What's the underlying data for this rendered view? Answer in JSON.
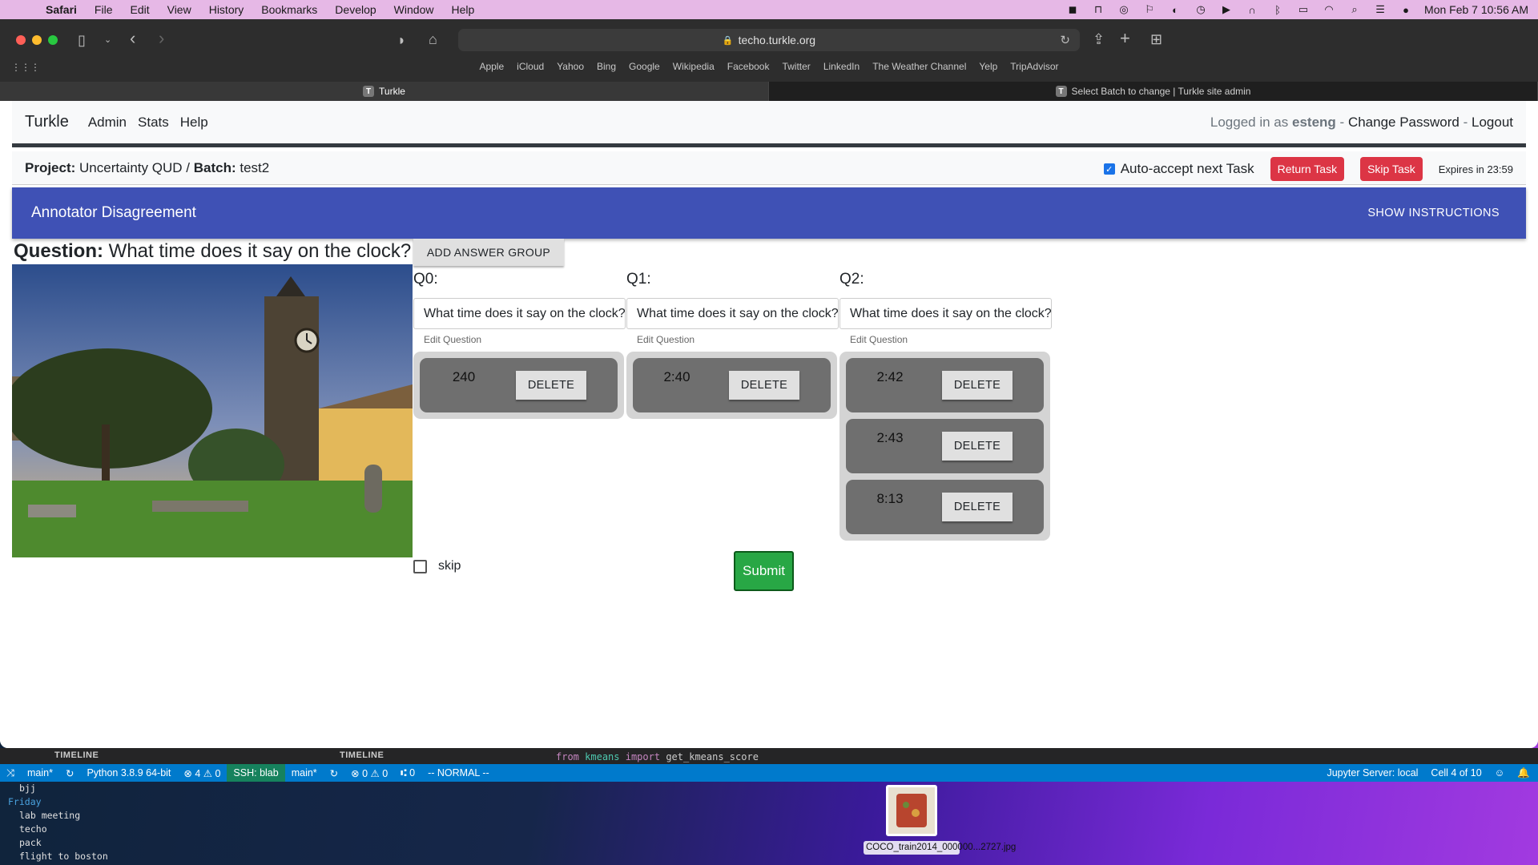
{
  "menubar": {
    "app": "Safari",
    "items": [
      "File",
      "Edit",
      "View",
      "History",
      "Bookmarks",
      "Develop",
      "Window",
      "Help"
    ],
    "datetime": "Mon Feb 7  10:56 AM"
  },
  "browser": {
    "url": "techo.turkle.org",
    "favorites": [
      "Apple",
      "iCloud",
      "Yahoo",
      "Bing",
      "Google",
      "Wikipedia",
      "Facebook",
      "Twitter",
      "LinkedIn",
      "The Weather Channel",
      "Yelp",
      "TripAdvisor"
    ],
    "tabs": [
      {
        "favicon": "T",
        "title": "Turkle"
      },
      {
        "favicon": "T",
        "title": "Select Batch to change | Turkle site admin"
      }
    ]
  },
  "nav": {
    "brand": "Turkle",
    "links": [
      "Admin",
      "Stats",
      "Help"
    ],
    "logged_in_prefix": "Logged in as",
    "username": "esteng",
    "sep": "-",
    "change_password": "Change Password",
    "logout": "Logout"
  },
  "project": {
    "project_label": "Project:",
    "project_name": "Uncertainty QUD",
    "slash": "/",
    "batch_label": "Batch:",
    "batch_name": "test2",
    "auto_accept_label": "Auto-accept next Task",
    "return_label": "Return Task",
    "skip_label": "Skip Task",
    "expires": "Expires in 23:59"
  },
  "banner": {
    "title": "Annotator Disagreement",
    "show_instructions": "SHOW INSTRUCTIONS"
  },
  "task": {
    "question_label": "Question:",
    "question_text": "What time does it say on the clock?",
    "add_group_label": "ADD ANSWER GROUP",
    "edit_question_label": "Edit Question",
    "delete_label": "DELETE",
    "groups": [
      {
        "label": "Q0:",
        "question": "What time does it say on the clock?",
        "answers": [
          "240"
        ]
      },
      {
        "label": "Q1:",
        "question": "What time does it say on the clock?",
        "answers": [
          "2:40"
        ]
      },
      {
        "label": "Q2:",
        "question": "What time does it say on the clock?",
        "answers": [
          "2:42",
          "2:43",
          "8:13"
        ]
      }
    ],
    "skip_label": "skip",
    "submit_label": "Submit"
  },
  "vscode": {
    "timeline_label": "TIMELINE",
    "code_kw1": "from",
    "code_mod": "kmeans",
    "code_kw2": "import",
    "code_fn": "get_kmeans_score",
    "branch": "main*",
    "python": "Python 3.8.9 64-bit",
    "problems_left": "⊗ 4  ⚠ 0",
    "ssh": "SSH: blab",
    "branch2": "main*",
    "problems_right": "⊗ 0  ⚠ 0",
    "ports": "⑆ 0",
    "mode": "-- NORMAL --",
    "jupyter": "Jupyter Server: local",
    "cell": "Cell 4 of 10"
  },
  "terminal": {
    "lines": [
      "bjj"
    ],
    "day": "Friday",
    "items": [
      "lab meeting",
      "techo",
      "pack",
      "flight to boston"
    ]
  },
  "desktop_file": {
    "name": "COCO_train2014_000000...2727.jpg"
  }
}
